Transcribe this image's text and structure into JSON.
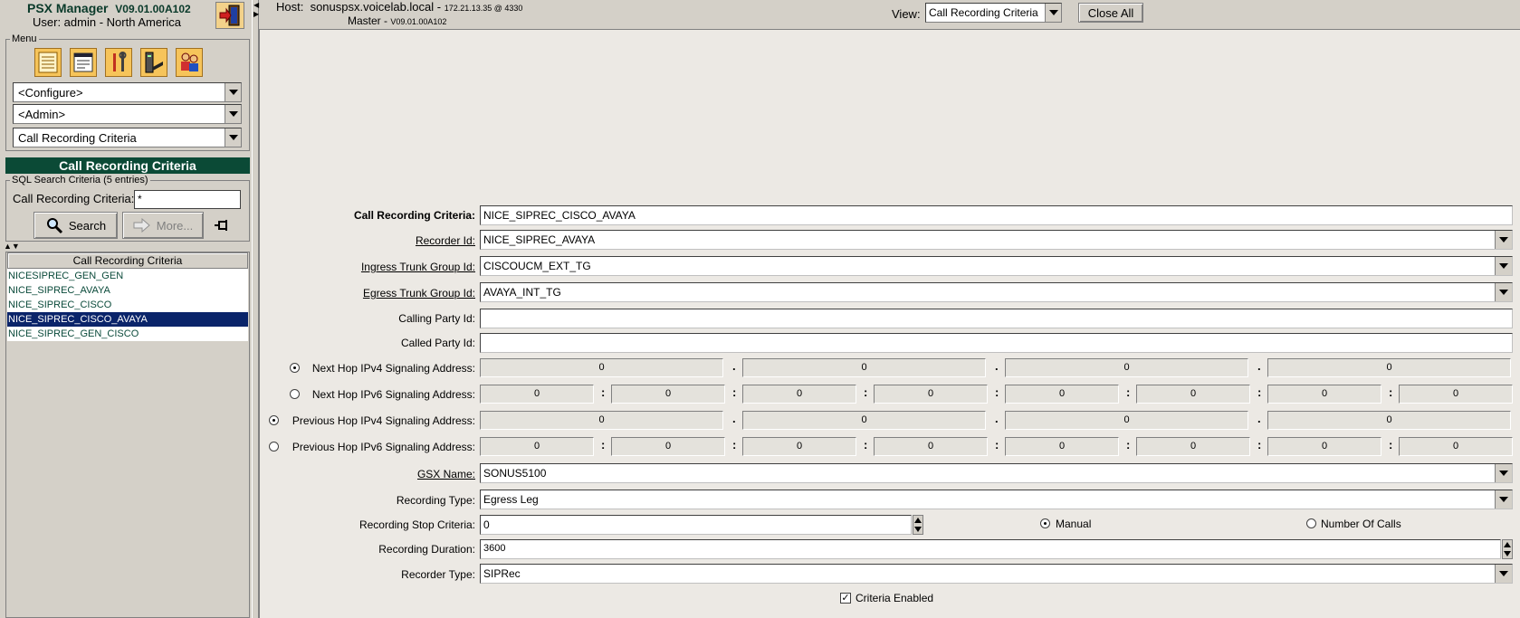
{
  "app": {
    "name": "PSX Manager",
    "version": "V09.01.00A102",
    "user_line": "User:  admin - North America"
  },
  "menu": {
    "legend": "Menu",
    "combo_configure": "<Configure>",
    "combo_admin": "<Admin>",
    "combo_entity": "Call Recording Criteria"
  },
  "search": {
    "title": "Call Recording Criteria",
    "legend": "SQL Search Criteria (5 entries)",
    "label": "Call Recording Criteria:",
    "value": "*",
    "search_btn": "Search",
    "more_btn": "More..."
  },
  "list": {
    "header": "Call Recording Criteria",
    "rows": [
      "NICESIPREC_GEN_GEN",
      "NICE_SIPREC_AVAYA",
      "NICE_SIPREC_CISCO",
      "NICE_SIPREC_CISCO_AVAYA",
      "NICE_SIPREC_GEN_CISCO"
    ],
    "selected_index": 3
  },
  "header": {
    "host_label": "Host:",
    "host_name": "sonuspsx.voicelab.local - ",
    "host_ip": "172.21.13.35 @ 4330",
    "master_label": "Master - ",
    "master_version": "V09.01.00A102",
    "view_label": "View:",
    "view_value": "Call Recording Criteria",
    "close_all": "Close All"
  },
  "form": {
    "crc_label": "Call Recording Criteria:",
    "crc_value": "NICE_SIPREC_CISCO_AVAYA",
    "recorder_label": "Recorder Id:",
    "recorder_value": "NICE_SIPREC_AVAYA",
    "ingress_label": "Ingress Trunk Group Id:",
    "ingress_value": "CISCOUCM_EXT_TG",
    "egress_label": "Egress Trunk Group Id:",
    "egress_value": "AVAYA_INT_TG",
    "calling_label": "Calling Party Id:",
    "calling_value": "",
    "called_label": "Called Party Id:",
    "called_value": "",
    "nh4_label": "Next Hop IPv4 Signaling Address:",
    "nh6_label": "Next Hop IPv6 Signaling Address:",
    "ph4_label": "Previous Hop IPv4 Signaling Address:",
    "ph6_label": "Previous Hop IPv6 Signaling Address:",
    "ipv4_octets": [
      "0",
      "0",
      "0",
      "0"
    ],
    "ipv6_groups": [
      "0",
      "0",
      "0",
      "0",
      "0",
      "0",
      "0",
      "0"
    ],
    "dot": ".",
    "colon": ":",
    "gsx_label": "GSX Name:",
    "gsx_value": "SONUS5100",
    "rectype_label": "Recording Type:",
    "rectype_value": "Egress Leg",
    "stop_label": "Recording Stop Criteria:",
    "stop_value": "0",
    "manual_label": "Manual",
    "numcalls_label": "Number Of Calls",
    "duration_label": "Recording Duration:",
    "duration_value": "3600",
    "recorder_type_label": "Recorder Type:",
    "recorder_type_value": "SIPRec",
    "criteria_enabled_label": "Criteria Enabled",
    "check_mark": "✓"
  }
}
